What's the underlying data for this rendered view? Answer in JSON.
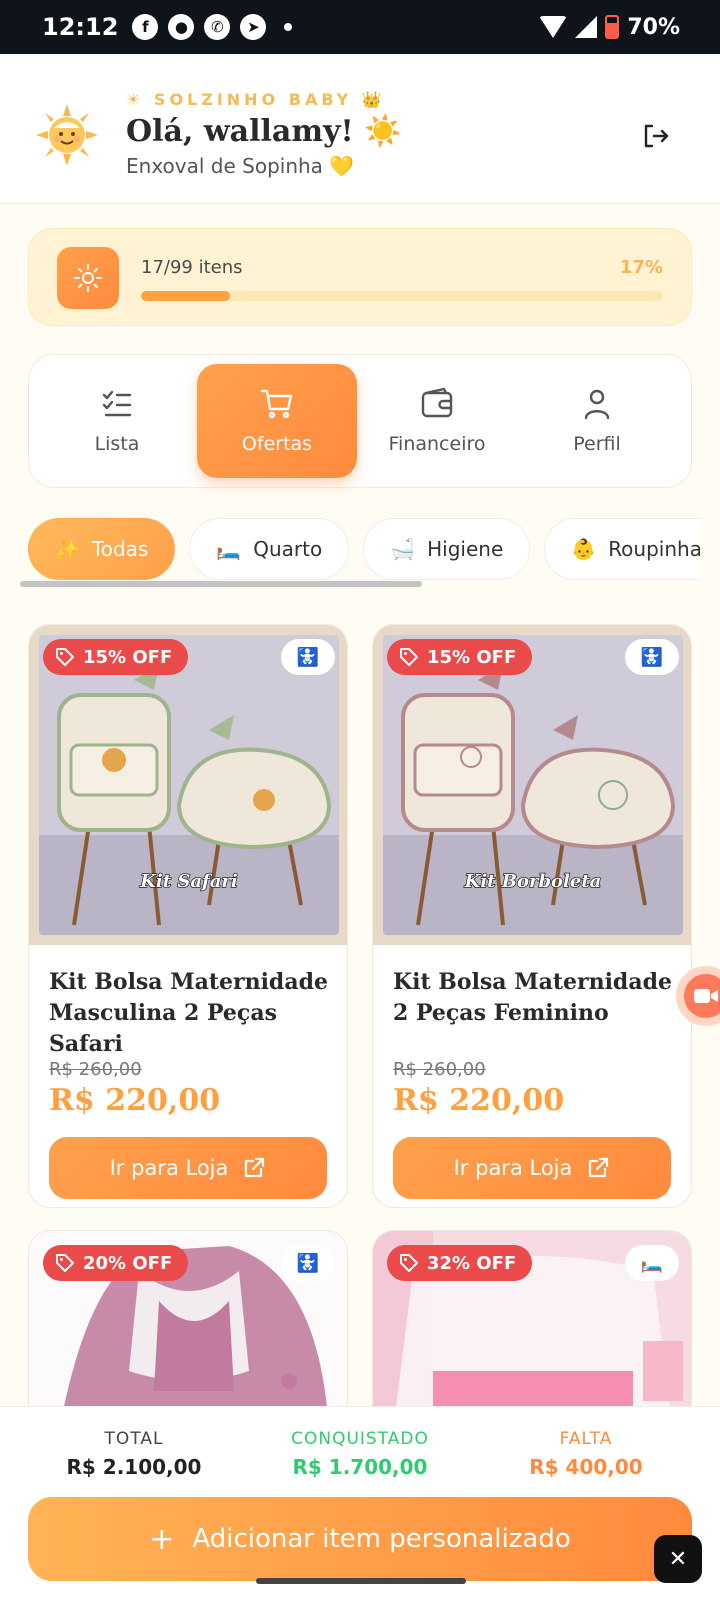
{
  "status_bar": {
    "time": "12:12",
    "battery": "70%",
    "app_icons": [
      "facebook-icon",
      "messages-icon",
      "whatsapp-icon",
      "telegram-icon"
    ]
  },
  "header": {
    "brand": "☀ SOLZINHO BABY 👑",
    "greeting": "Olá, wallamy! ☀️",
    "subtitle": "Enxoval de Sopinha 💛"
  },
  "progress": {
    "label": "17/99 itens",
    "percent_label": "17%",
    "fraction": 0.17
  },
  "nav": {
    "items": [
      {
        "label": "Lista",
        "icon": "checklist-icon",
        "active": false
      },
      {
        "label": "Ofertas",
        "icon": "cart-icon",
        "active": true
      },
      {
        "label": "Financeiro",
        "icon": "wallet-icon",
        "active": false
      },
      {
        "label": "Perfil",
        "icon": "user-icon",
        "active": false
      }
    ]
  },
  "chips": [
    {
      "emoji": "✨",
      "label": "Todas",
      "active": true
    },
    {
      "emoji": "🛏️",
      "label": "Quarto",
      "active": false
    },
    {
      "emoji": "🛁",
      "label": "Higiene",
      "active": false
    },
    {
      "emoji": "👶",
      "label": "Roupinhas",
      "active": false
    }
  ],
  "products": [
    {
      "badge": "15% OFF",
      "category_icon": "🚼",
      "image_caption": "Kit Safari",
      "title": "Kit Bolsa Maternidade Masculina 2 Peças Safari",
      "old_price": "R$ 260,00",
      "price": "R$ 220,00",
      "button": "Ir para Loja"
    },
    {
      "badge": "15% OFF",
      "category_icon": "🚼",
      "image_caption": "Kit Borboleta",
      "title": "Kit Bolsa Maternidade 2 Peças Feminino",
      "old_price": "R$ 260,00",
      "price": "R$ 220,00",
      "button": "Ir para Loja"
    },
    {
      "badge": "20% OFF",
      "category_icon": "🚼"
    },
    {
      "badge": "32% OFF",
      "category_icon": "🛏️"
    }
  ],
  "totals": {
    "total_label": "TOTAL",
    "total_value": "R$ 2.100,00",
    "achieved_label": "CONQUISTADO",
    "achieved_value": "R$ 1.700,00",
    "missing_label": "FALTA",
    "missing_value": "R$ 400,00"
  },
  "add_button": {
    "label": "Adicionar item personalizado",
    "plus": "+"
  },
  "colors": {
    "accent": "#FF9A45",
    "achieved": "#2ECC71",
    "missing": "#FF8A3D",
    "badge": "#EA4A4A"
  }
}
